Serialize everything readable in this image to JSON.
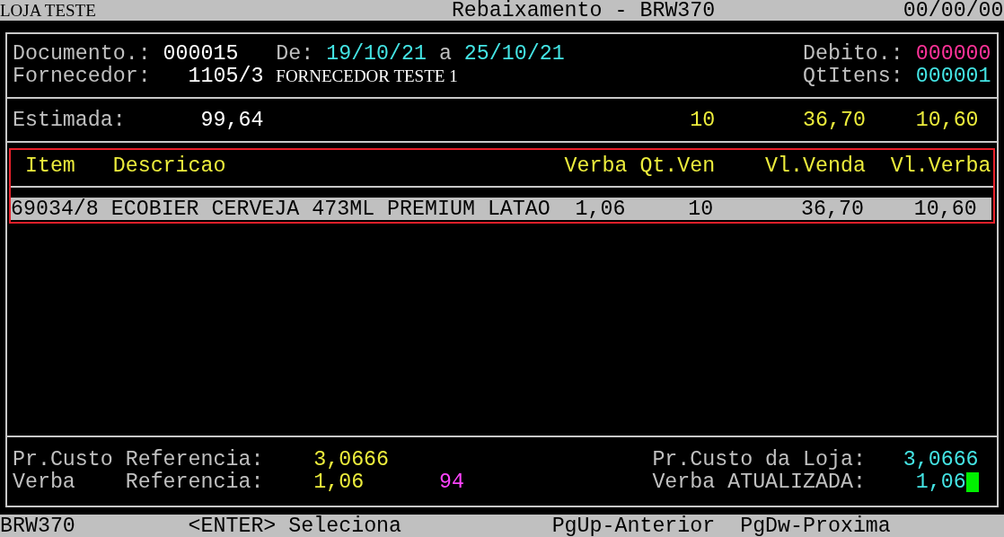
{
  "title_bar": {
    "store": "LOJA TESTE",
    "title": "Rebaixamento - BRW370",
    "date": "00/00/00"
  },
  "document": {
    "label": "Documento.:",
    "value": "000015"
  },
  "period": {
    "label": "De:",
    "start": "19/10/21",
    "separator": "a",
    "end": "25/10/21"
  },
  "debit": {
    "label": "Debito.:",
    "value": "000000"
  },
  "supplier": {
    "label": "Fornecedor:",
    "code": "1105/3",
    "name": "FORNECEDOR TESTE 1"
  },
  "item_count": {
    "label": "QtItens:",
    "value": "000001"
  },
  "estimate": {
    "label": "Estimada:",
    "values": [
      "99,64",
      "10",
      "36,70",
      "10,60"
    ]
  },
  "table": {
    "columns": [
      "Item",
      "Descricao",
      "Verba",
      "Qt.Ven",
      "Vl.Venda",
      "Vl.Verba"
    ],
    "rows": [
      {
        "selected": true,
        "cells": [
          "69034/8",
          "ECOBIER CERVEJA 473ML PREMIUM LATAO",
          "1,06",
          "10",
          "36,70",
          "10,60"
        ]
      }
    ]
  },
  "reference_cost": {
    "label": "Pr.Custo",
    "sublabel": "Referencia:",
    "value": "3,0666"
  },
  "reference_allowance": {
    "label": "Verba",
    "sublabel": "Referencia:",
    "value": "1,06",
    "extra": "94"
  },
  "store_cost": {
    "label": "Pr.Custo da Loja:",
    "value": "3,0666"
  },
  "updated_allowance": {
    "label": "Verba ATUALIZADA:",
    "value": "1,06",
    "cursor": true
  },
  "footer": [
    "BRW370",
    "<ENTER> Seleciona",
    "PgUp-Anterior",
    "PgDw-Proxima"
  ]
}
